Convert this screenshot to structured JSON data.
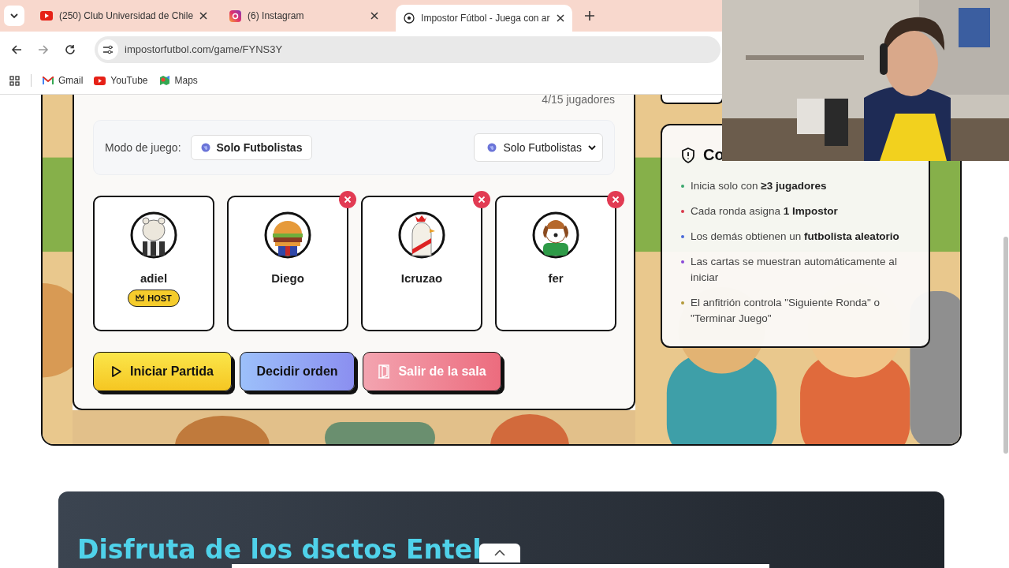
{
  "browser": {
    "tabs": [
      {
        "title": "(250) Club Universidad de Chile",
        "selected": false
      },
      {
        "title": "(6) Instagram",
        "selected": false
      },
      {
        "title": "Impostor Fútbol - Juega con ar",
        "selected": true
      }
    ],
    "url": "impostorfutbol.com/game/FYNS3Y",
    "bookmarks": [
      {
        "label": "Gmail"
      },
      {
        "label": "YouTube"
      },
      {
        "label": "Maps"
      }
    ]
  },
  "lobby": {
    "player_count": "4/15 jugadores",
    "mode_label": "Modo de juego:",
    "mode_chip": "Solo Futbolistas",
    "mode_select": "Solo Futbolistas",
    "players": [
      {
        "name": "adiel",
        "host": true,
        "badge": "HOST",
        "removable": false
      },
      {
        "name": "Diego",
        "host": false,
        "removable": true
      },
      {
        "name": "Icruzao",
        "host": false,
        "removable": true
      },
      {
        "name": "fer",
        "host": false,
        "removable": true
      }
    ],
    "buttons": [
      {
        "label": "Iniciar Partida",
        "kind": "start"
      },
      {
        "label": "Decidir orden",
        "kind": "order"
      },
      {
        "label": "Salir de la sala",
        "kind": "leave"
      }
    ]
  },
  "rules": {
    "title": "Co",
    "items": [
      {
        "text": "Inicia solo con  **≥3 jugadores**",
        "color": "#3aa76d"
      },
      {
        "text": "Cada ronda asigna  **1 Impostor**",
        "color": "#d9394b"
      },
      {
        "text": "Los demás obtienen un  **futbolista aleatorio**",
        "color": "#4a6ad8"
      },
      {
        "text": "Las cartas se muestran automáticamente al iniciar",
        "color": "#8a4ad8"
      },
      {
        "text": "El anfitrión controla \"Siguiente Ronda\" o \"Terminar Juego\"",
        "color": "#b39a3a"
      }
    ]
  },
  "banner": {
    "title": "Disfruta de los dsctos Entel"
  }
}
